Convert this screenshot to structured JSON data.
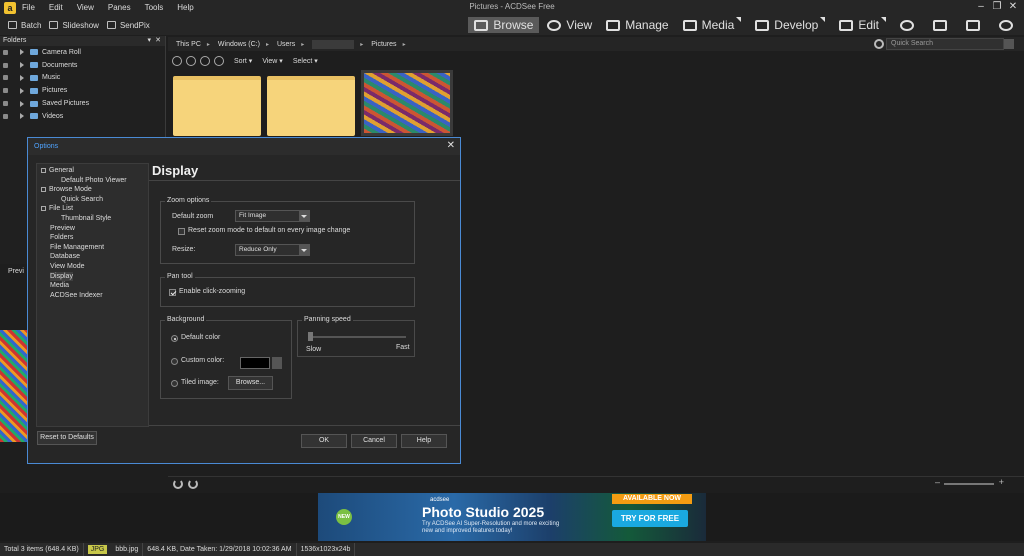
{
  "window": {
    "title": "Pictures - ACDSee Free",
    "logo_letter": "a",
    "controls": {
      "minimize": "–",
      "restore": "❐",
      "close": "✕"
    }
  },
  "menu": [
    "File",
    "Edit",
    "View",
    "Panes",
    "Tools",
    "Help"
  ],
  "toolbar": {
    "batch": "Batch",
    "slideshow": "Slideshow",
    "sendpix": "SendPix"
  },
  "modes": {
    "browse": "Browse",
    "view": "View",
    "manage": "Manage",
    "media": "Media",
    "develop": "Develop",
    "edit": "Edit",
    "active": "browse"
  },
  "folders_panel": {
    "title": "Folders",
    "items": [
      "Camera Roll",
      "Documents",
      "Music",
      "Pictures",
      "Saved Pictures",
      "Videos"
    ],
    "preview_label": "Previ"
  },
  "address": {
    "crumbs": [
      "This PC",
      "Windows (C:)",
      "Users",
      "Pictures"
    ],
    "search_placeholder": "Quick Search"
  },
  "sortbar": {
    "sort": "Sort",
    "view": "View",
    "select": "Select"
  },
  "dialog": {
    "title": "Options",
    "close": "✕",
    "nav": [
      {
        "label": "General",
        "collapsible": true
      },
      {
        "label": "Default Photo Viewer",
        "indent": true
      },
      {
        "label": "Browse Mode",
        "collapsible": true
      },
      {
        "label": "Quick Search",
        "indent": true
      },
      {
        "label": "File List",
        "collapsible": true
      },
      {
        "label": "Thumbnail Style",
        "indent": true
      },
      {
        "label": "Preview"
      },
      {
        "label": "Folders"
      },
      {
        "label": "File Management"
      },
      {
        "label": "Database"
      },
      {
        "label": "View Mode"
      },
      {
        "label": "Display",
        "selected": true
      },
      {
        "label": "Media"
      },
      {
        "label": "ACDSee Indexer"
      }
    ],
    "content_title": "Display",
    "zoom": {
      "group_label": "Zoom options",
      "default_zoom_label": "Default zoom",
      "default_zoom_value": "Fit Image",
      "reset_label": "Reset zoom mode to default on every image change",
      "reset_checked": false,
      "resize_label": "Resize:",
      "resize_value": "Reduce Only"
    },
    "pan": {
      "group_label": "Pan tool",
      "enable_label": "Enable click-zooming",
      "enable_checked": true
    },
    "background": {
      "group_label": "Background",
      "default_color": "Default color",
      "custom_color": "Custom color:",
      "tiled_image": "Tiled image:",
      "browse": "Browse...",
      "selected": "default",
      "custom_swatch_color": "#000000"
    },
    "panning_speed": {
      "group_label": "Panning speed",
      "slow": "Slow",
      "fast": "Fast",
      "value": 0
    },
    "buttons": {
      "reset": "Reset to Defaults",
      "ok": "OK",
      "cancel": "Cancel",
      "help": "Help"
    }
  },
  "ad": {
    "brand": "acdsee",
    "product": "Photo Studio 2025",
    "text": "Try ACDSee AI Super-Resolution and more exciting new and improved features today!",
    "badge": "NEW",
    "available": "AVAILABLE NOW",
    "cta": "TRY FOR FREE"
  },
  "status": {
    "total": "Total 3 items  (648.4 KB)",
    "filetype": "JPG",
    "filename": "bbb.jpg",
    "details": "648.4 KB, Date Taken: 1/29/2018 10:02:36 AM",
    "dimensions": "1536x1023x24b"
  },
  "colors": {
    "accent": "#4a8ad4",
    "folder": "#f6d47b",
    "dialog_title": "#4fa3ff"
  }
}
